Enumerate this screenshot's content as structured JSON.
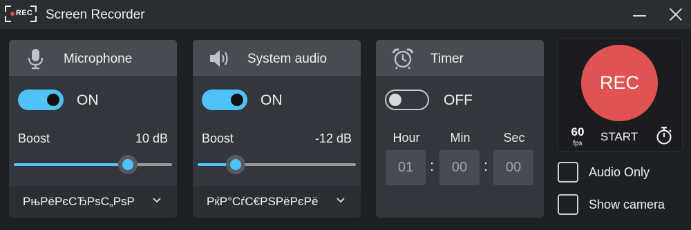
{
  "window": {
    "title": "Screen Recorder",
    "logo_text": "REC"
  },
  "microphone": {
    "title": "Microphone",
    "toggle_state": "ON",
    "boost_label": "Boost",
    "boost_value": "10 dB",
    "boost_level": 0.72,
    "device": "РњРёРєСЂРѕС„РѕР"
  },
  "system_audio": {
    "title": "System audio",
    "toggle_state": "ON",
    "boost_label": "Boost",
    "boost_value": "-12 dB",
    "boost_level": 0.24,
    "device": "РќР°СѓС€РЅРёРєРё"
  },
  "timer": {
    "title": "Timer",
    "toggle_state": "OFF",
    "hour_label": "Hour",
    "min_label": "Min",
    "sec_label": "Sec",
    "hour": "01",
    "min": "00",
    "sec": "00"
  },
  "recorder": {
    "rec_label": "REC",
    "fps_value": "60",
    "fps_unit": "fps",
    "start_label": "START",
    "accent": "#e15252"
  },
  "options": {
    "audio_only": "Audio Only",
    "show_camera": "Show camera"
  },
  "colors": {
    "toggle_on": "#4fc3f7",
    "background": "#1e2124",
    "panel": "#33373d"
  }
}
